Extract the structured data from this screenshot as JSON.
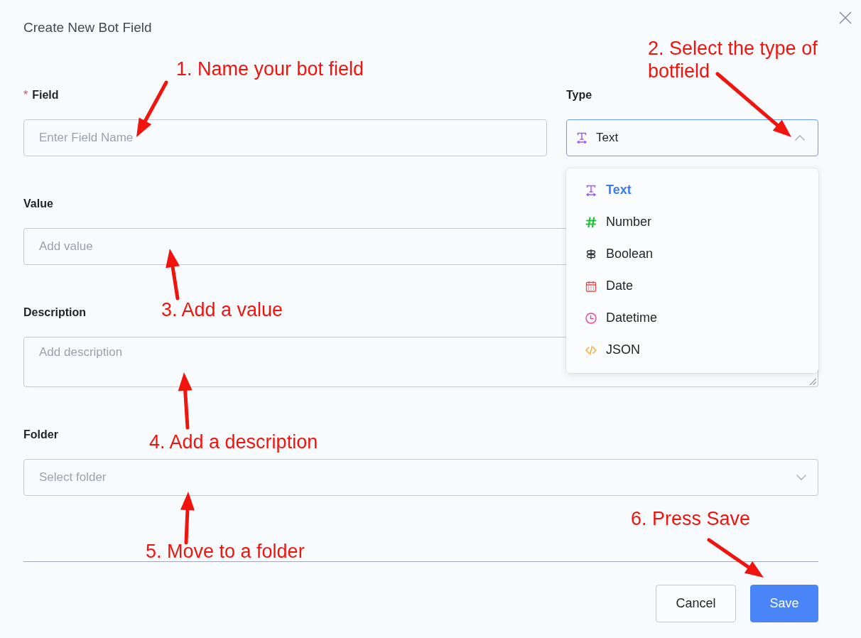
{
  "dialog": {
    "title": "Create New Bot Field"
  },
  "form": {
    "field": {
      "label": "Field",
      "required_mark": "*",
      "placeholder": "Enter Field Name"
    },
    "type": {
      "label": "Type",
      "value": "Text",
      "expanded": true,
      "options": [
        {
          "label": "Text",
          "kind": "text",
          "selected": true
        },
        {
          "label": "Number",
          "kind": "number",
          "selected": false
        },
        {
          "label": "Boolean",
          "kind": "boolean",
          "selected": false
        },
        {
          "label": "Date",
          "kind": "date",
          "selected": false
        },
        {
          "label": "Datetime",
          "kind": "datetime",
          "selected": false
        },
        {
          "label": "JSON",
          "kind": "json",
          "selected": false
        }
      ]
    },
    "value": {
      "label": "Value",
      "placeholder": "Add value"
    },
    "description": {
      "label": "Description",
      "placeholder": "Add description"
    },
    "folder": {
      "label": "Folder",
      "placeholder": "Select folder",
      "expanded": false
    }
  },
  "buttons": [
    {
      "label": "Cancel",
      "kind": "secondary"
    },
    {
      "label": "Save",
      "kind": "primary"
    }
  ],
  "annotations": [
    "1. Name your bot field",
    "2. Select the type of botfield",
    "3. Add a value",
    "4. Add a description",
    "5. Move to a folder",
    "6. Press Save"
  ]
}
